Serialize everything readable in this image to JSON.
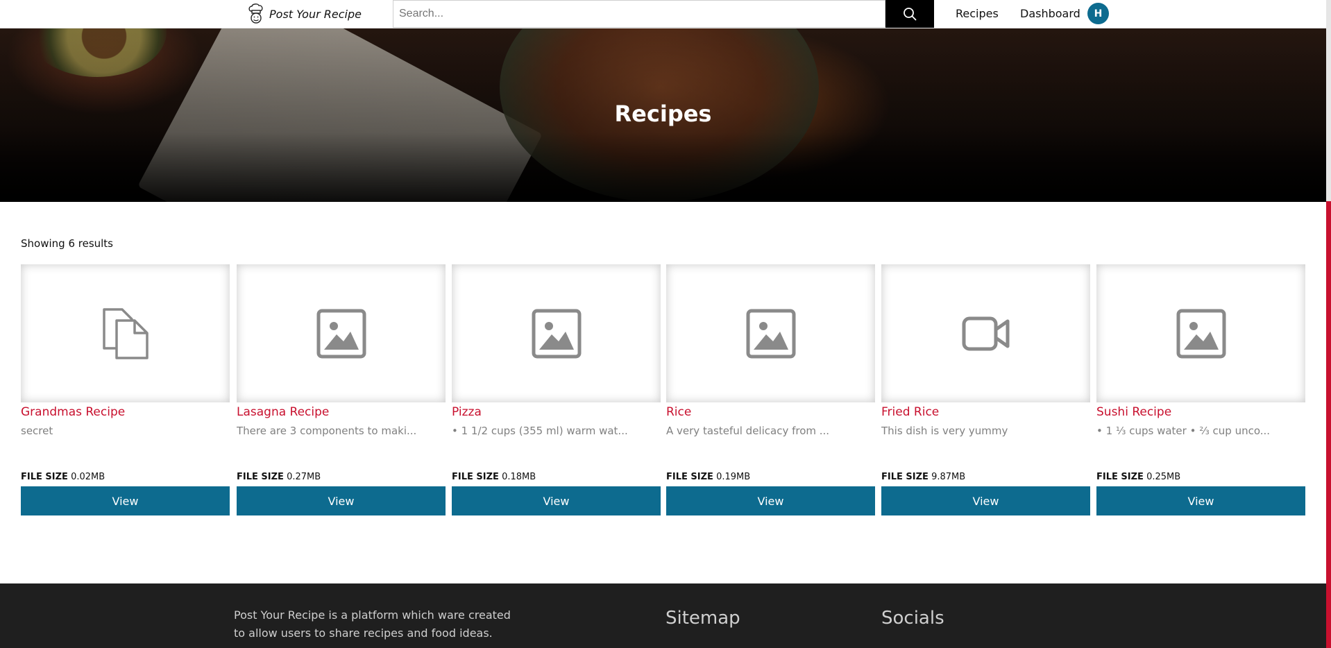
{
  "header": {
    "brand": "Post Your Recipe",
    "search_placeholder": "Search...",
    "nav": {
      "recipes": "Recipes",
      "dashboard": "Dashboard"
    },
    "avatar_initial": "H",
    "colors": {
      "accent": "#0d6b8f",
      "search_button": "#000000"
    }
  },
  "hero": {
    "title": "Recipes"
  },
  "results": {
    "count_label": "Showing 6 results"
  },
  "cards": [
    {
      "icon": "file-icon",
      "title": "Grandmas Recipe",
      "desc": "secret",
      "size_label": "FILE SIZE",
      "size": "0.02MB",
      "button": "View"
    },
    {
      "icon": "image-icon",
      "title": "Lasagna Recipe",
      "desc": "There are 3 components to maki...",
      "size_label": "FILE SIZE",
      "size": "0.27MB",
      "button": "View"
    },
    {
      "icon": "image-icon",
      "title": "Pizza",
      "desc": "• 1 1/2 cups (355 ml) warm wat...",
      "size_label": "FILE SIZE",
      "size": "0.18MB",
      "button": "View"
    },
    {
      "icon": "image-icon",
      "title": "Rice",
      "desc": "A very tasteful delicacy from ...",
      "size_label": "FILE SIZE",
      "size": "0.19MB",
      "button": "View"
    },
    {
      "icon": "video-icon",
      "title": "Fried Rice",
      "desc": "This dish is very yummy",
      "size_label": "FILE SIZE",
      "size": "9.87MB",
      "button": "View"
    },
    {
      "icon": "image-icon",
      "title": "Sushi Recipe",
      "desc": "• 1 ⅓ cups water • ⅔ cup unco...",
      "size_label": "FILE SIZE",
      "size": "0.25MB",
      "button": "View"
    }
  ],
  "footer": {
    "about": "Post Your Recipe is a platform which ware created to allow users to share recipes and food ideas.",
    "sitemap": "Sitemap",
    "socials": "Socials"
  },
  "colors": {
    "title_red": "#c8102e",
    "footer_bg": "#1f1f1f"
  }
}
